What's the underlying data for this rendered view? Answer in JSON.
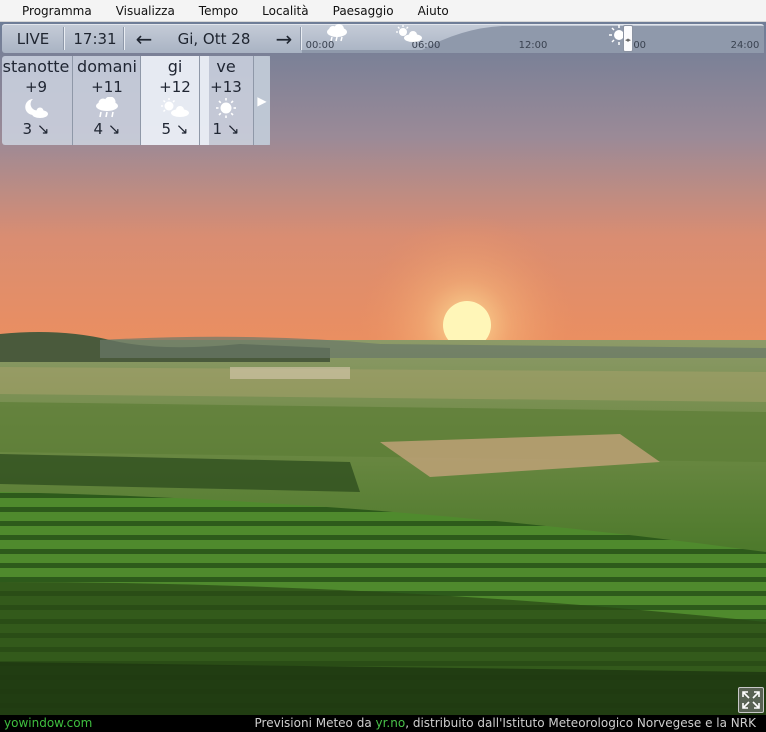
{
  "menu": [
    "Programma",
    "Visualizza",
    "Tempo",
    "Località",
    "Paesaggio",
    "Aiuto"
  ],
  "toolbar": {
    "live_label": "LIVE",
    "time": "17:31",
    "prev_arrow": "←",
    "date": "Gi, Ott 28",
    "next_arrow": "→"
  },
  "timeline": {
    "ticks": [
      "00:00",
      "06:00",
      "12:00",
      ":00",
      "24:00"
    ],
    "icons": [
      "rain-cloud-icon",
      "sun-cloud-icon",
      "sun-icon"
    ],
    "slider_grip": "◂▸"
  },
  "forecast": {
    "days": [
      {
        "name": "stanotte",
        "temp": "+9",
        "icon": "moon-cloud-icon",
        "wind": "3 ↘"
      },
      {
        "name": "domani",
        "temp": "+11",
        "icon": "rain-cloud-icon",
        "wind": "4 ↘"
      },
      {
        "name": "gi",
        "temp": "+12",
        "icon": "sun-cloud-icon",
        "wind": "5 ↘"
      },
      {
        "name": "ve",
        "temp": "+13",
        "icon": "sun-icon",
        "wind": "1 ↘"
      }
    ],
    "more_arrow": "▶",
    "selected_index": 2
  },
  "status": {
    "brand": "yowindow.com",
    "credit_prefix": "Previsioni Meteo da ",
    "credit_link": "yr.no",
    "credit_suffix": ", distribuito dall'Istituto Meteorologico Norvegese e la NRK"
  },
  "colors": {
    "sky_top": "#6f7e97",
    "sky_horizon": "#e98c62",
    "link_green": "#49c249"
  }
}
